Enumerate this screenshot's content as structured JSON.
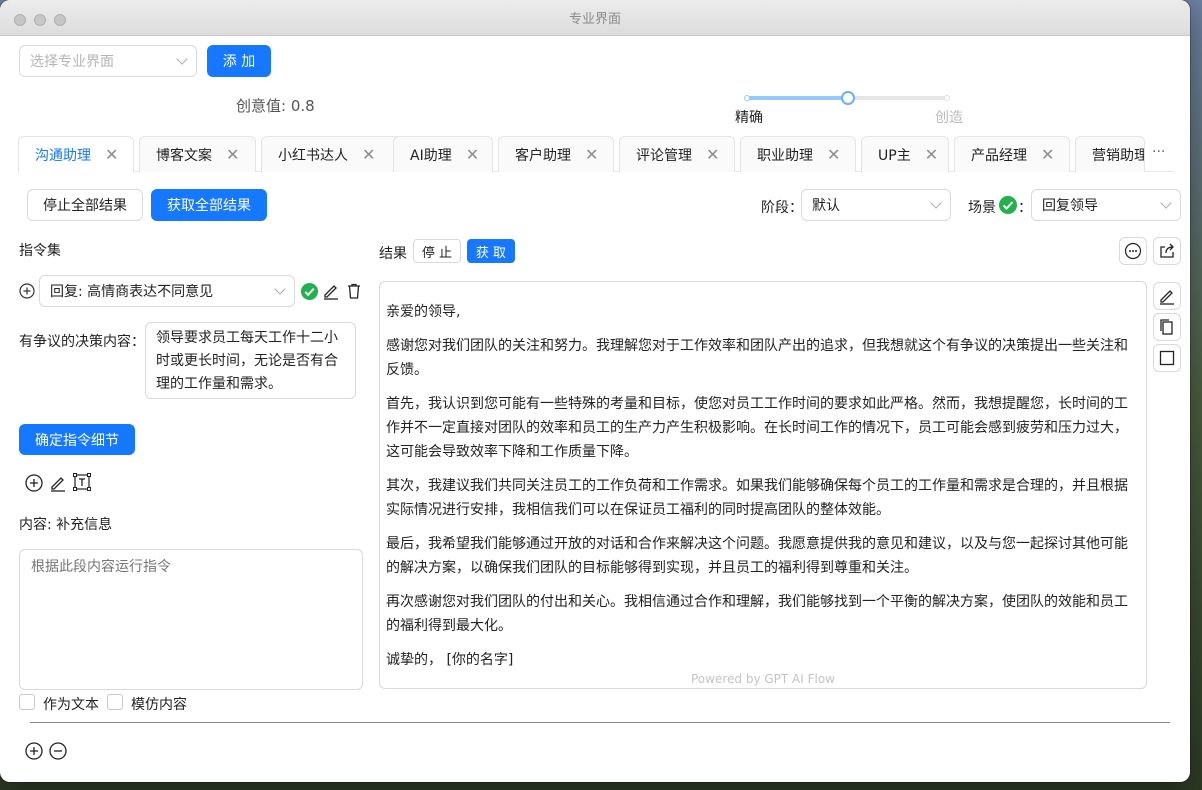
{
  "window": {
    "title": "专业界面"
  },
  "top": {
    "select_placeholder": "选择专业界面",
    "add_label": "添 加",
    "creativity_label": "创意值: 0.8",
    "creativity_value": 0.8,
    "slider_left": "精确",
    "slider_right": "创造"
  },
  "tabs": [
    {
      "label": "沟通助理",
      "active": true
    },
    {
      "label": "博客文案"
    },
    {
      "label": "小红书达人"
    },
    {
      "label": "AI助理"
    },
    {
      "label": "客户助理"
    },
    {
      "label": "评论管理"
    },
    {
      "label": "职业助理"
    },
    {
      "label": "UP主"
    },
    {
      "label": "产品经理"
    },
    {
      "label": "营销助理"
    }
  ],
  "tab_more": "···",
  "toolbar": {
    "stop_all": "停止全部结果",
    "get_all": "获取全部结果",
    "stage_label": "阶段：",
    "stage_value": "默认",
    "scene_label": "场景",
    "scene_colon": "：",
    "scene_value": "回复领导"
  },
  "instructions": {
    "title": "指令集",
    "selected": "回复: 高情商表达不同意见",
    "field_label": "有争议的决策内容：",
    "field_value": "领导要求员工每天工作十二小时或更长时间，无论是否有合理的工作量和需求。",
    "confirm": "确定指令细节",
    "content_label": "内容: 补充信息",
    "content_placeholder": "根据此段内容运行指令",
    "as_text": "作为文本",
    "imitate": "模仿内容"
  },
  "result": {
    "label": "结果",
    "stop": "停 止",
    "get": "获 取",
    "paragraphs": [
      "亲爱的领导,",
      "感谢您对我们团队的关注和努力。我理解您对于工作效率和团队产出的追求，但我想就这个有争议的决策提出一些关注和反馈。",
      "首先，我认识到您可能有一些特殊的考量和目标，使您对员工工作时间的要求如此严格。然而，我想提醒您，长时间的工作并不一定直接对团队的效率和员工的生产力产生积极影响。在长时间工作的情况下，员工可能会感到疲劳和压力过大，这可能会导致效率下降和工作质量下降。",
      "其次，我建议我们共同关注员工的工作负荷和工作需求。如果我们能够确保每个员工的工作量和需求是合理的，并且根据实际情况进行安排，我相信我们可以在保证员工福利的同时提高团队的整体效能。",
      "最后，我希望我们能够通过开放的对话和合作来解决这个问题。我愿意提供我的意见和建议，以及与您一起探讨其他可能的解决方案，以确保我们团队的目标能够得到实现，并且员工的福利得到尊重和关注。",
      "再次感谢您对我们团队的付出和关心。我相信通过合作和理解，我们能够找到一个平衡的解决方案，使团队的效能和员工的福利得到最大化。",
      "诚挚的，  [你的名字]"
    ],
    "powered": "Powered by GPT AI Flow"
  },
  "colors": {
    "primary": "#1677ff",
    "success": "#22b14c"
  }
}
